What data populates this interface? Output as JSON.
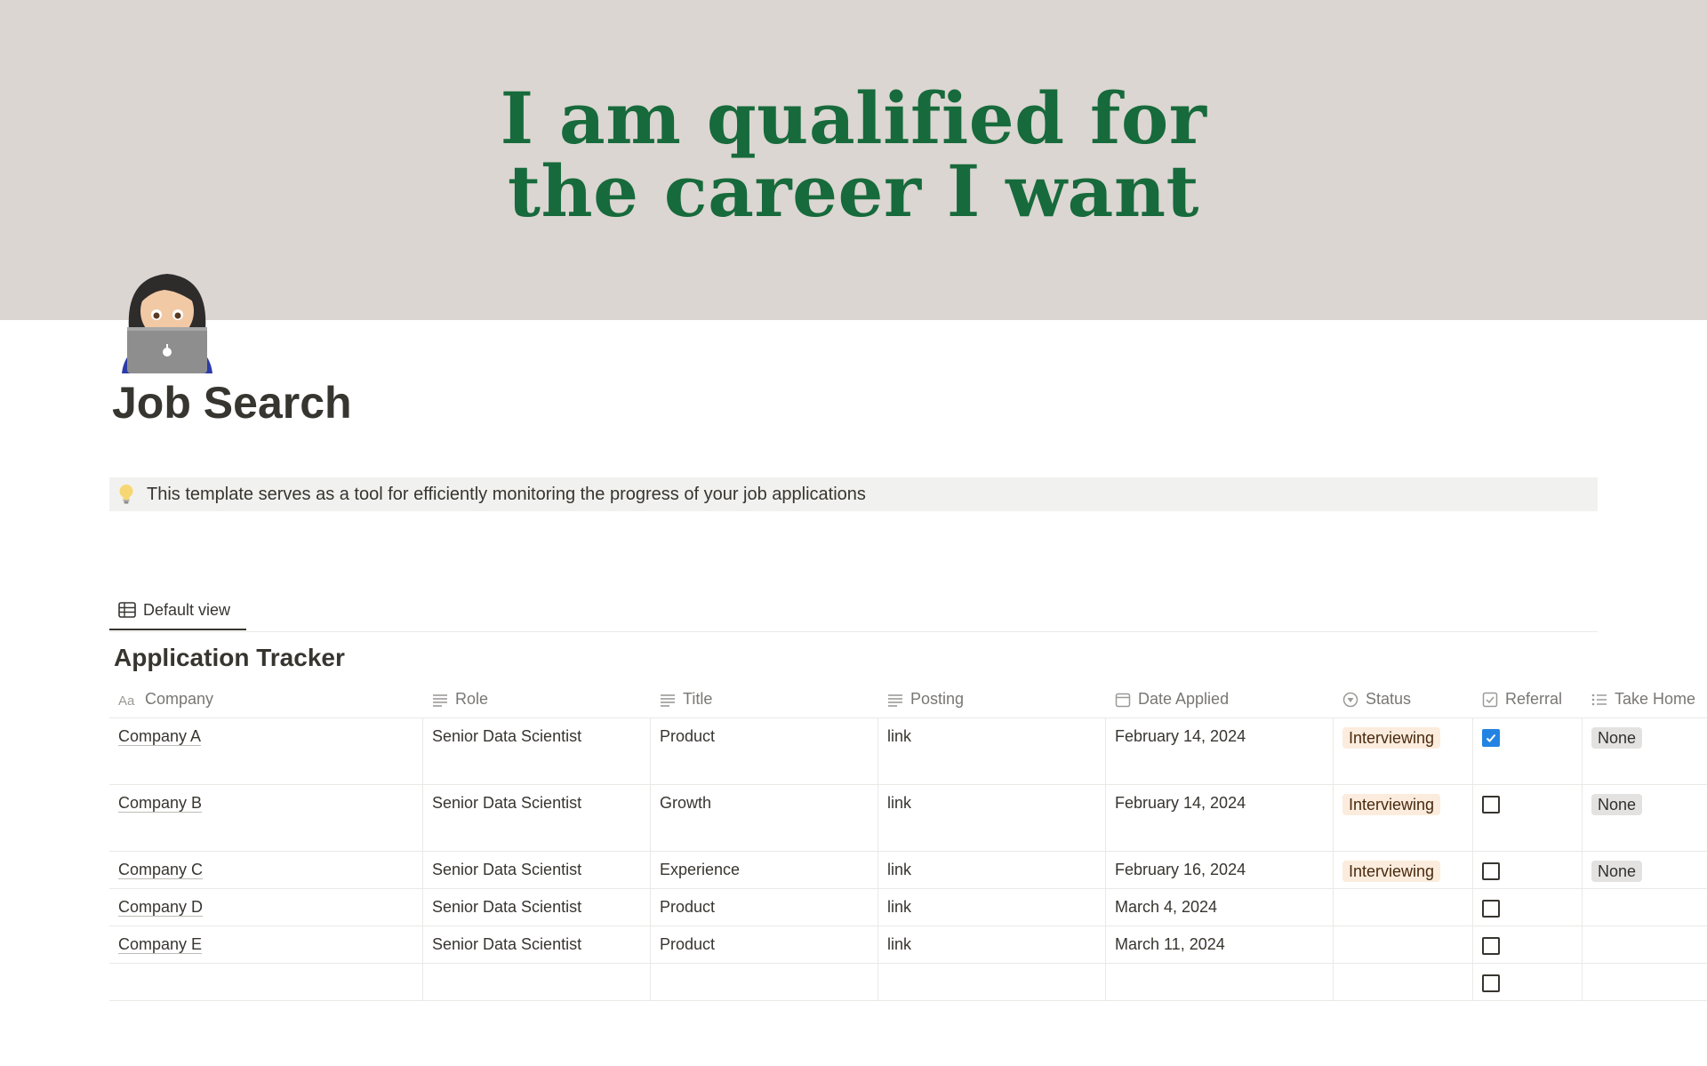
{
  "cover": {
    "line1": "I am qualified for",
    "line2": "the career I want",
    "background": "#dbd6d2",
    "text_color": "#176a3b"
  },
  "page": {
    "icon": "woman-technologist-icon",
    "title": "Job Search"
  },
  "callout": {
    "icon": "lightbulb-icon",
    "text": "This template serves as a tool for efficiently monitoring the progress of your job applications"
  },
  "views": {
    "active_label": "Default view",
    "active_icon": "table-icon"
  },
  "database": {
    "title": "Application Tracker",
    "columns": [
      {
        "label": "Company",
        "icon": "title-aa-icon"
      },
      {
        "label": "Role",
        "icon": "text-lines-icon"
      },
      {
        "label": "Title",
        "icon": "text-lines-icon"
      },
      {
        "label": "Posting",
        "icon": "text-lines-icon"
      },
      {
        "label": "Date Applied",
        "icon": "calendar-icon"
      },
      {
        "label": "Status",
        "icon": "status-icon"
      },
      {
        "label": "Referral",
        "icon": "checkbox-icon"
      },
      {
        "label": "Take Home",
        "icon": "list-icon"
      }
    ],
    "rows": [
      {
        "company": "Company A",
        "role": "Senior Data Scientist",
        "title": "Product",
        "posting": "link",
        "date": "February 14, 2024",
        "status": "Interviewing",
        "referral": true,
        "take_home": "None"
      },
      {
        "company": "Company B",
        "role": "Senior Data Scientist",
        "title": "Growth",
        "posting": "link",
        "date": "February 14, 2024",
        "status": "Interviewing",
        "referral": false,
        "take_home": "None"
      },
      {
        "company": "Company C",
        "role": "Senior Data Scientist",
        "title": "Experience",
        "posting": "link",
        "date": "February 16, 2024",
        "status": "Interviewing",
        "referral": false,
        "take_home": "None"
      },
      {
        "company": "Company D",
        "role": "Senior Data Scientist",
        "title": "Product",
        "posting": "link",
        "date": "March 4, 2024",
        "status": "",
        "referral": false,
        "take_home": ""
      },
      {
        "company": "Company E",
        "role": "Senior Data Scientist",
        "title": "Product",
        "posting": "link",
        "date": "March 11, 2024",
        "status": "",
        "referral": false,
        "take_home": ""
      }
    ],
    "status_colors": {
      "interviewing_bg": "#fbecdd",
      "none_bg": "#e3e2e0"
    },
    "checked_color": "#2383e2"
  }
}
